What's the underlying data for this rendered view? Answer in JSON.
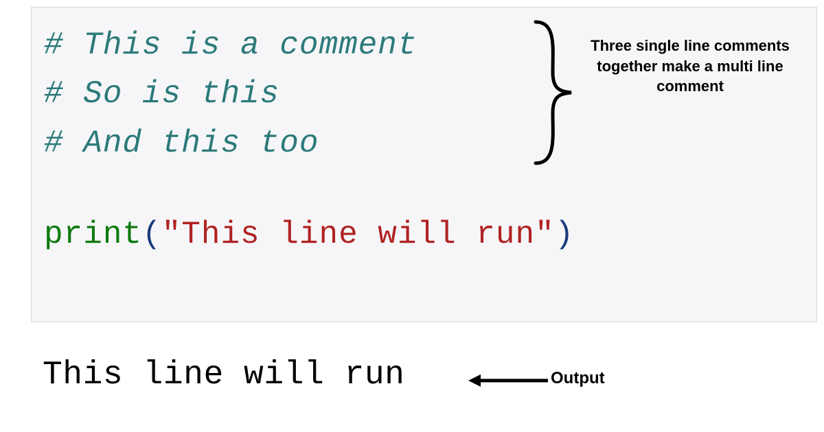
{
  "code": {
    "comment1": "# This is a comment",
    "comment2": "# So is this",
    "comment3": "# And this too",
    "print_func": "print",
    "paren_open": "(",
    "string_literal": "\"This line will run\"",
    "paren_close": ")"
  },
  "annotations": {
    "brace_label": "Three single line comments together make a multi line comment",
    "output_label": "Output"
  },
  "output": {
    "text": "This line will run"
  }
}
